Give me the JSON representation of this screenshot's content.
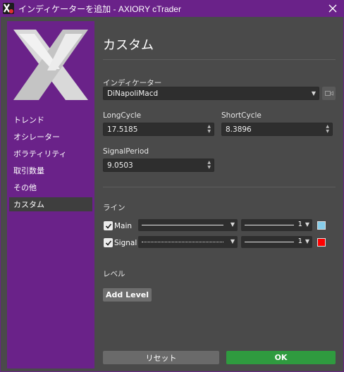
{
  "window": {
    "title": "インディケーターを追加 - AXIORY cTrader",
    "close_icon": "close-icon",
    "app_icon": "ctrader-app-icon",
    "accent_color": "#6a2289"
  },
  "sidebar": {
    "logo": "X",
    "items": [
      {
        "label": "トレンド"
      },
      {
        "label": "オシレーター"
      },
      {
        "label": "ボラティリティ"
      },
      {
        "label": "取引数量"
      },
      {
        "label": "その他"
      },
      {
        "label": "カスタム",
        "active": true
      }
    ]
  },
  "main": {
    "title": "カスタム",
    "indicator": {
      "label": "インディケーター",
      "value": "DiNapoliMacd"
    },
    "params": {
      "long_cycle": {
        "label": "LongCycle",
        "value": "17.5185"
      },
      "short_cycle": {
        "label": "ShortCycle",
        "value": "8.3896"
      },
      "signal_period": {
        "label": "SignalPeriod",
        "value": "9.0503"
      }
    },
    "lines": {
      "section_label": "ライン",
      "items": [
        {
          "name": "Main",
          "checked": true,
          "style": "solid",
          "width": "1",
          "color": "#87ceeb"
        },
        {
          "name": "Signal",
          "checked": true,
          "style": "dotted",
          "width": "1",
          "color": "#ff0000"
        }
      ]
    },
    "levels": {
      "section_label": "レベル",
      "add_label": "Add Level"
    },
    "buttons": {
      "reset": "リセット",
      "ok": "OK"
    }
  }
}
